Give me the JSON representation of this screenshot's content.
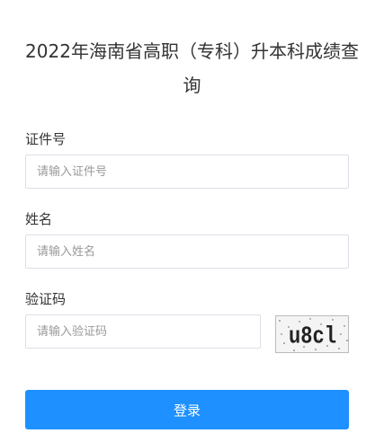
{
  "page": {
    "title": "2022年海南省高职（专科）升本科成绩查询"
  },
  "form": {
    "id_label": "证件号",
    "id_placeholder": "请输入证件号",
    "name_label": "姓名",
    "name_placeholder": "请输入姓名",
    "captcha_label": "验证码",
    "captcha_placeholder": "请输入验证码",
    "captcha_text": "u8cl",
    "submit_label": "登录"
  },
  "colors": {
    "button_bg": "#1e90ff",
    "input_border": "#dcdfe6"
  }
}
